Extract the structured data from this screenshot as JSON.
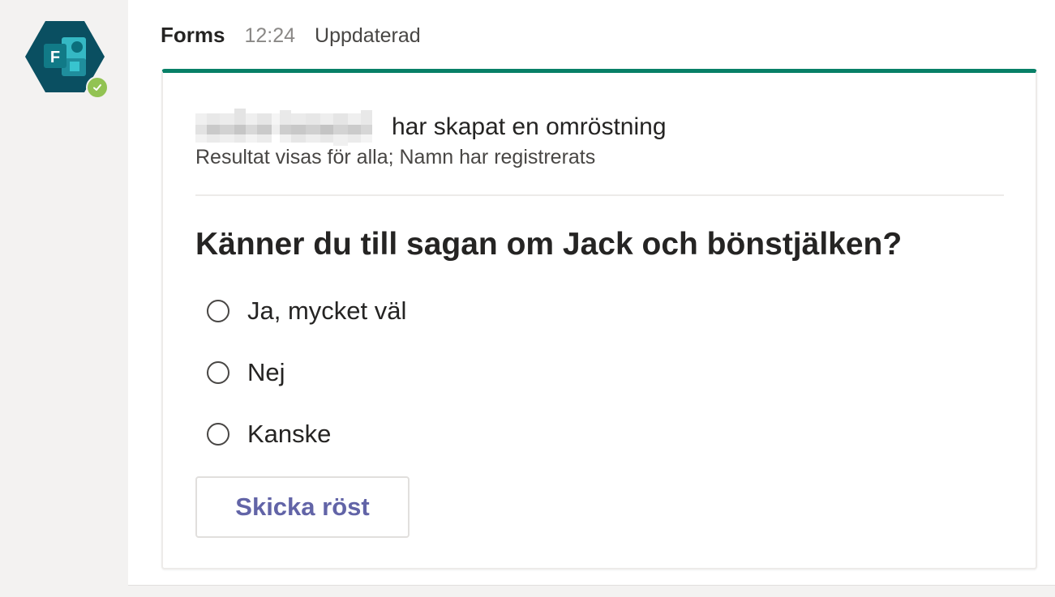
{
  "app": {
    "icon": "forms-app-icon",
    "presence_status": "available",
    "presence_color": "#92c353",
    "brand_color": "#088067",
    "accent_color": "#6264a7"
  },
  "message": {
    "sender": "Forms",
    "time": "12:24",
    "status": "Uppdaterad"
  },
  "poll": {
    "creator_action": "har skapat en omröstning",
    "settings": "Resultat visas för alla; Namn har registrerats",
    "question": "Känner du till sagan om Jack och bönstjälken?",
    "options": [
      {
        "label": "Ja, mycket väl",
        "selected": false
      },
      {
        "label": "Nej",
        "selected": false
      },
      {
        "label": "Kanske",
        "selected": false
      }
    ],
    "submit_label": "Skicka röst"
  }
}
